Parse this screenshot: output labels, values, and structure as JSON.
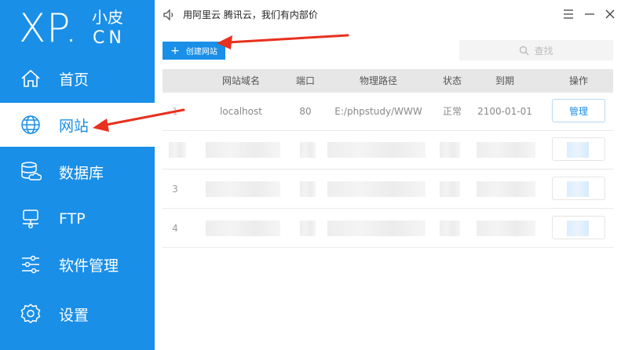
{
  "logo": {
    "xp": "XP.",
    "cn_top": "小皮",
    "cn_bot": "CN"
  },
  "nav": [
    {
      "label": "首页",
      "icon": "home-icon",
      "active": false
    },
    {
      "label": "网站",
      "icon": "globe-icon",
      "active": true
    },
    {
      "label": "数据库",
      "icon": "database-icon",
      "active": false
    },
    {
      "label": "FTP",
      "icon": "ftp-icon",
      "active": false
    },
    {
      "label": "软件管理",
      "icon": "sliders-icon",
      "active": false
    },
    {
      "label": "设置",
      "icon": "gear-icon",
      "active": false
    }
  ],
  "notice": {
    "text": "用阿里云 腾讯云，我们有内部价"
  },
  "toolbar": {
    "create_label": "创建网站",
    "search_placeholder": "查找"
  },
  "table": {
    "headers": [
      "网站域名",
      "端口",
      "物理路径",
      "状态",
      "到期",
      "操作"
    ],
    "rows": [
      {
        "index": "1",
        "domain": "localhost",
        "port": "80",
        "path": "E:/phpstudy/WWW",
        "status": "正常",
        "expiry": "2100-01-01",
        "action": "管理"
      },
      {
        "index": "",
        "blurred": true
      },
      {
        "index": "3",
        "blurred": true
      },
      {
        "index": "4",
        "blurred": true
      }
    ]
  },
  "colors": {
    "accent": "#1a8fe8",
    "sidebar": "#1a8fe8",
    "arrow": "#e8301e"
  }
}
